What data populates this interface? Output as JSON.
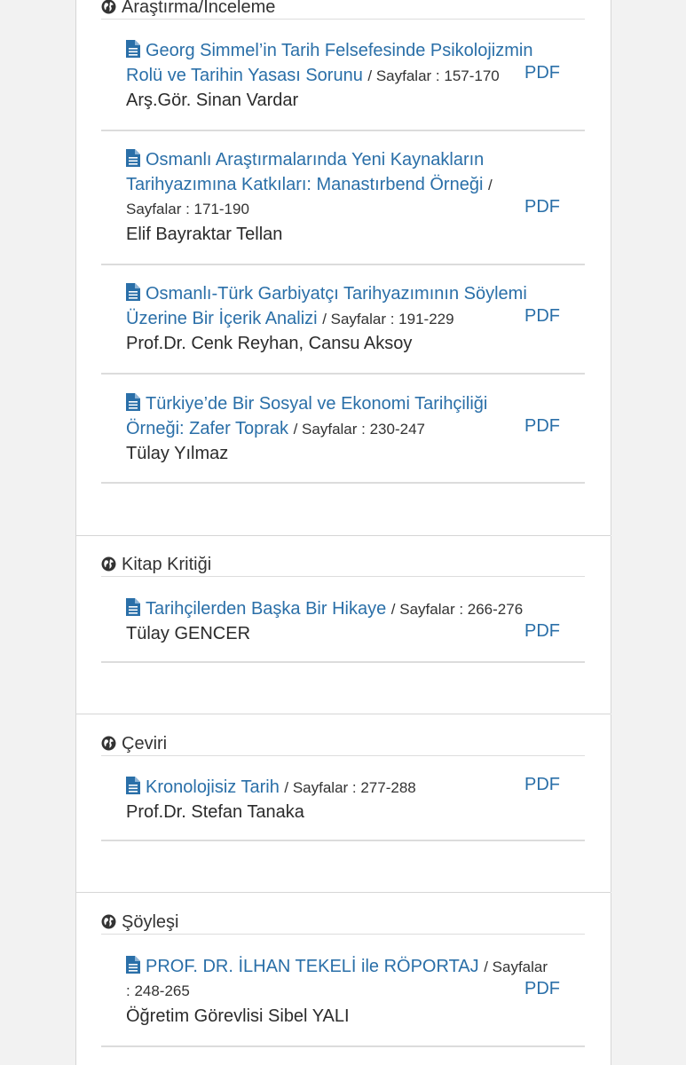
{
  "sections": [
    {
      "title": "Araştırma/İnceleme",
      "articles": [
        {
          "title_lines": [
            "Georg Simmel’in Tarih Felsefesinde Psikolojizmin",
            "Rolü ve Tarihin Yasası Sorunu"
          ],
          "pages": "/ Sayfalar : 157-170",
          "author": "Arş.Gör. Sinan Vardar",
          "pdf": "PDF"
        },
        {
          "title_lines": [
            "Osmanlı Araştırmalarında Yeni Kaynakların",
            "Tarihyazımına Katkıları: Manastırbend Örneği"
          ],
          "pages_line_suffix": "/",
          "pages": "Sayfalar : 171-190",
          "author": "Elif Bayraktar Tellan",
          "pdf": "PDF"
        },
        {
          "title_lines": [
            "Osmanlı-Türk Garbiyatçı Tarihyazımının Söylemi",
            "Üzerine Bir İçerik Analizi"
          ],
          "pages": "/ Sayfalar : 191-229",
          "author": "Prof.Dr. Cenk Reyhan, Cansu Aksoy",
          "pdf": "PDF"
        },
        {
          "title_lines": [
            "Türkiye’de Bir Sosyal ve Ekonomi Tarihçiliği",
            "Örneği: Zafer Toprak"
          ],
          "pages": "/ Sayfalar : 230-247",
          "author": "Tülay Yılmaz",
          "pdf": "PDF"
        }
      ]
    },
    {
      "title": "Kitap Kritiği",
      "articles": [
        {
          "title_lines": [
            "Tarihçilerden Başka Bir Hikaye"
          ],
          "pages": "/ Sayfalar : 266-276",
          "author": "Tülay GENCER",
          "pdf": "PDF"
        }
      ]
    },
    {
      "title": "Çeviri",
      "articles": [
        {
          "title_lines": [
            "Kronolojisiz Tarih"
          ],
          "pages": "/ Sayfalar : 277-288",
          "author": "Prof.Dr. Stefan Tanaka",
          "pdf": "PDF"
        }
      ]
    },
    {
      "title": "Şöyleşi",
      "articles": [
        {
          "title_lines": [
            "PROF. DR. İLHAN TEKELİ ile RÖPORTAJ"
          ],
          "pages_a": "/ Sayfalar",
          "pages_b": ": 248-265",
          "author": "Öğretim Görevlisi Sibel YALI",
          "pdf": "PDF"
        }
      ]
    }
  ],
  "icons": {
    "section": "globe-icon",
    "article": "document-icon"
  },
  "colors": {
    "link": "#2a6fa8",
    "background": "#f2f2f2",
    "panel": "#ffffff"
  }
}
